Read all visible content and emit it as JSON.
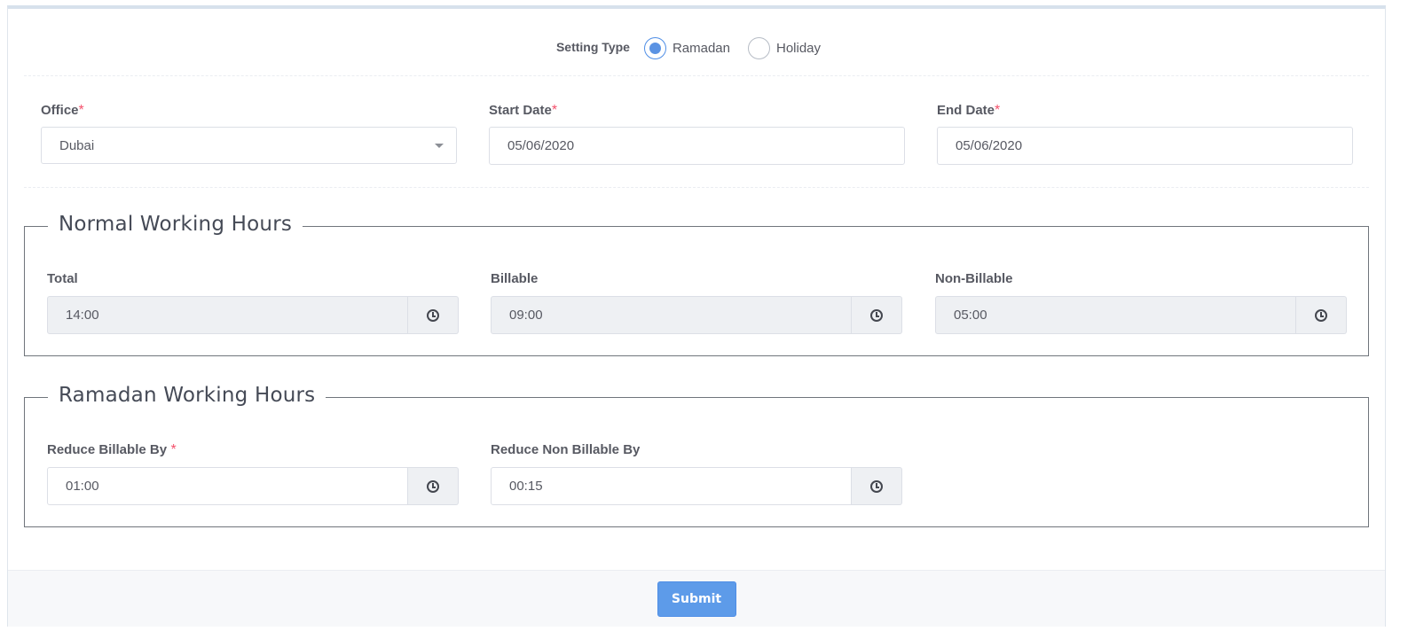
{
  "setting_type": {
    "label": "Setting Type",
    "options": [
      {
        "label": "Ramadan",
        "checked": true
      },
      {
        "label": "Holiday",
        "checked": false
      }
    ]
  },
  "office": {
    "label": "Office",
    "required_mark": "*",
    "value": "Dubai"
  },
  "start_date": {
    "label": "Start Date",
    "required_mark": "*",
    "value": "05/06/2020"
  },
  "end_date": {
    "label": "End Date",
    "required_mark": "*",
    "value": "05/06/2020"
  },
  "normal_hours": {
    "title": "Normal Working Hours",
    "total": {
      "label": "Total",
      "value": "14:00"
    },
    "billable": {
      "label": "Billable",
      "value": "09:00"
    },
    "non_billable": {
      "label": "Non-Billable",
      "value": "05:00"
    }
  },
  "ramadan_hours": {
    "title": "Ramadan Working Hours",
    "reduce_billable": {
      "label": "Reduce Billable By",
      "required_mark": "*",
      "value": "01:00"
    },
    "reduce_non_billable": {
      "label": "Reduce Non Billable By",
      "value": "00:15"
    }
  },
  "footer": {
    "submit_label": "Submit"
  },
  "colors": {
    "accent": "#5d9be9",
    "required": "#f4516c"
  }
}
